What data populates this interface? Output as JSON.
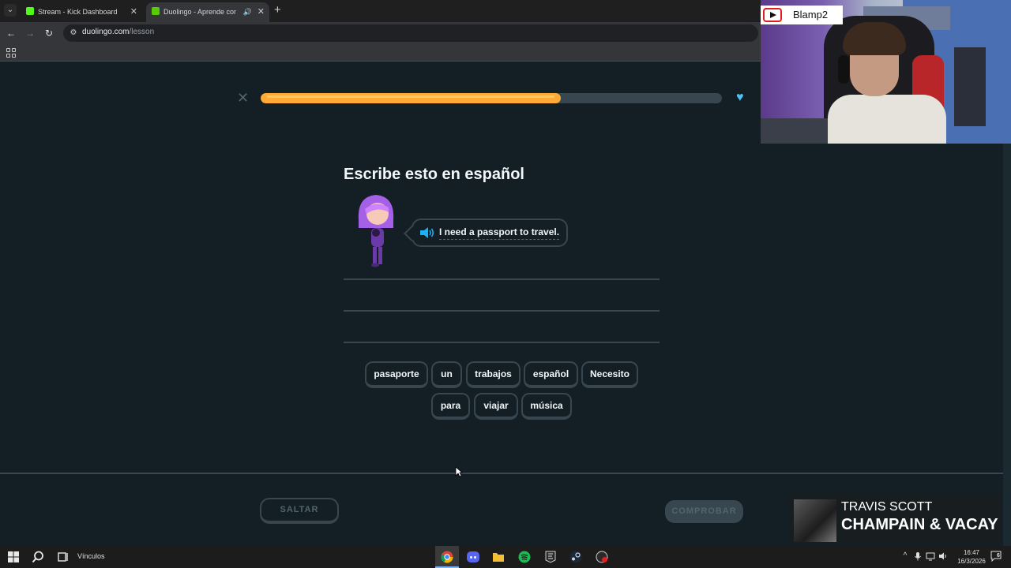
{
  "browser": {
    "tabs": [
      {
        "title": "Stream - Kick Dashboard",
        "favicon": "kick-icon",
        "color": "#53fc18"
      },
      {
        "title": "Duolingo - Aprende con le",
        "favicon": "duolingo-icon",
        "color": "#58cc02",
        "active": true
      }
    ],
    "url": {
      "domain": "duolingo.com",
      "path": "/lesson"
    }
  },
  "lesson": {
    "progress": 0.65,
    "prompt": "Escribe esto en español",
    "sentence": "I need a passport to travel.",
    "word_bank_row1": [
      "pasaporte",
      "un",
      "trabajos",
      "español",
      "Necesito"
    ],
    "word_bank_row2": [
      "para",
      "viajar",
      "música"
    ],
    "skip_label": "SALTAR",
    "check_label": "COMPROBAR"
  },
  "colors": {
    "background": "#131f24",
    "progress": "#ffab33",
    "border": "#37464f",
    "text": "#f1f7fb",
    "muted": "#52656d"
  },
  "webcam": {
    "channel": "Blamp2"
  },
  "now_playing": {
    "artist": "TRAVIS SCOTT",
    "song": "CHAMPAIN & VACAY"
  },
  "taskbar": {
    "label": "Vínculos",
    "time": "16:47",
    "date": "16/3/2026",
    "notifications": "6"
  }
}
